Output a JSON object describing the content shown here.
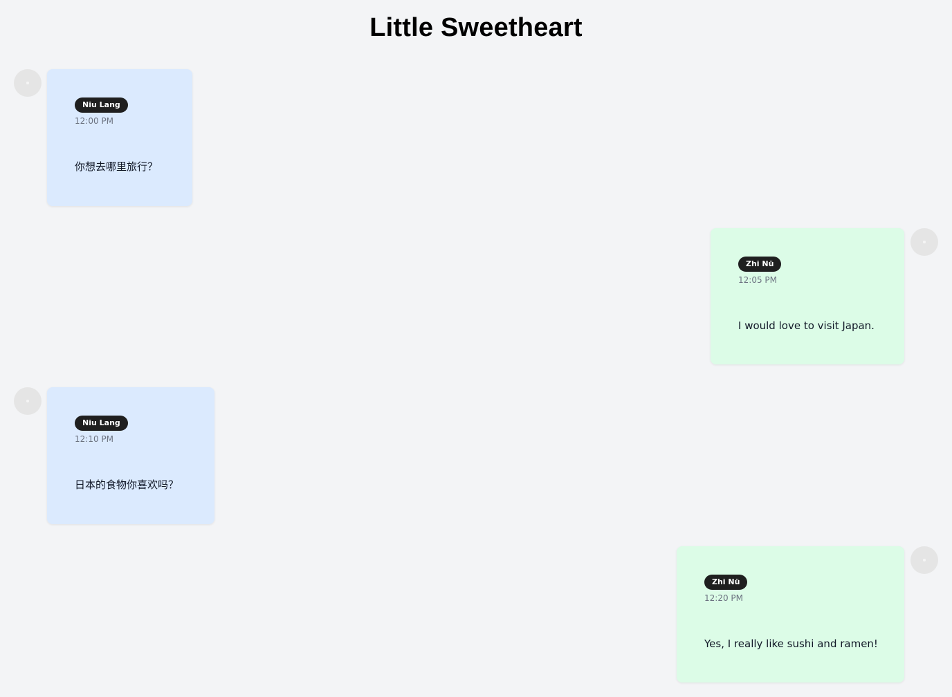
{
  "header": {
    "title": "Little Sweetheart"
  },
  "colors": {
    "background": "#f3f4f6",
    "left_bubble": "#dbeafe",
    "right_bubble": "#dcfce7",
    "badge": "#1f1f1f",
    "timestamp": "#6b7280"
  },
  "messages": [
    {
      "sender": "Niu Lang",
      "time": "12:00 PM",
      "text": "你想去哪里旅行？",
      "side": "left"
    },
    {
      "sender": "Zhi Nü",
      "time": "12:05 PM",
      "text": "I would love to visit Japan.",
      "side": "right"
    },
    {
      "sender": "Niu Lang",
      "time": "12:10 PM",
      "text": "日本的食物你喜欢吗？",
      "side": "left"
    },
    {
      "sender": "Zhi Nü",
      "time": "12:20 PM",
      "text": "Yes, I really like sushi and ramen!",
      "side": "right"
    }
  ]
}
